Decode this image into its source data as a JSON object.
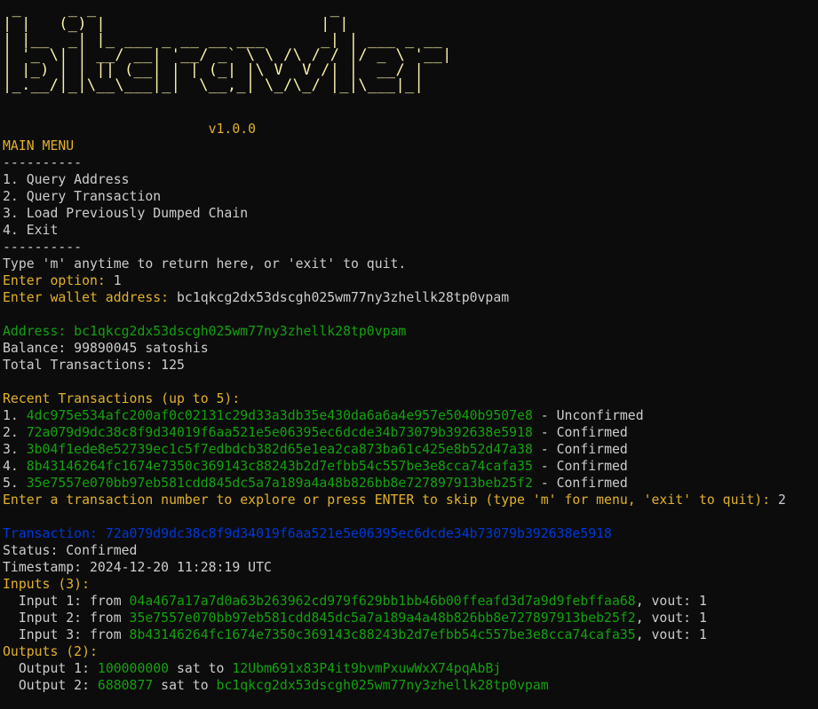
{
  "banner": [
    " _     _ _                         _",
    "| |   (_) |                       | |",
    "| |__  _| |_ ___ _ __ __ ___      _| | ___ _ __",
    "| '_ \\| | __/ __| '__/ _` \\ \\ /\\ / / |/ _ \\ '__|",
    "| |_) | | || (__| | | (_| |\\ V  V /| |  __/ |",
    "|_.__/|_|\\__\\___|_|  \\__,_| \\_/\\_/ |_|\\___|_|"
  ],
  "version": "                          v1.0.0",
  "menu": {
    "title": "MAIN MENU",
    "separator": "----------",
    "items": [
      "1. Query Address",
      "2. Query Transaction",
      "3. Load Previously Dumped Chain",
      "4. Exit"
    ],
    "separator_bottom": "----------",
    "hint": "Type 'm' anytime to return here, or 'exit' to quit."
  },
  "prompts": {
    "option_label": "Enter option: ",
    "option_value": "1",
    "wallet_label": "Enter wallet address: ",
    "wallet_value": "bc1qkcg2dx53dscgh025wm77ny3zhellk28tp0vpam"
  },
  "address_info": {
    "address_line": "Address: bc1qkcg2dx53dscgh025wm77ny3zhellk28tp0vpam",
    "balance_line": "Balance: 99890045 satoshis",
    "total_line": "Total Transactions: 125"
  },
  "recent": {
    "title": "Recent Transactions (up to 5):",
    "items": [
      {
        "num": "1. ",
        "hash": "4dc975e534afc200af0c02131c29d33a3db35e430da6a6a4e957e5040b9507e8",
        "status": " - Unconfirmed"
      },
      {
        "num": "2. ",
        "hash": "72a079d9dc38c8f9d34019f6aa521e5e06395ec6dcde34b73079b392638e5918",
        "status": " - Confirmed"
      },
      {
        "num": "3. ",
        "hash": "3b04f1ede8e52739ec1c5f7edbdcb382d65e1ea2ca873ba61c425e8b52d47a38",
        "status": " - Confirmed"
      },
      {
        "num": "4. ",
        "hash": "8b43146264fc1674e7350c369143c88243b2d7efbb54c557be3e8cca74cafa35",
        "status": " - Confirmed"
      },
      {
        "num": "5. ",
        "hash": "35e7557e070bb97eb581cdd845dc5a7a189a4a48b826bb8e727897913beb25f2",
        "status": " - Confirmed"
      }
    ],
    "explore_prompt": "Enter a transaction number to explore or press ENTER to skip (type 'm' for menu, 'exit' to quit): ",
    "explore_value": "2"
  },
  "transaction": {
    "label": "Transaction: ",
    "hash": "72a079d9dc38c8f9d34019f6aa521e5e06395ec6dcde34b73079b392638e5918",
    "status_line": "Status: Confirmed",
    "timestamp_line": "Timestamp: 2024-12-20 11:28:19 UTC",
    "inputs_title": "Inputs (3):",
    "inputs": [
      {
        "prefix": "  Input 1: from ",
        "hash": "04a467a17a7d0a63b263962cd979f629bb1bb46b00ffeafd3d7a9d9febffaa68",
        "suffix": ", vout: 1"
      },
      {
        "prefix": "  Input 2: from ",
        "hash": "35e7557e070bb97eb581cdd845dc5a7a189a4a48b826bb8e727897913beb25f2",
        "suffix": ", vout: 1"
      },
      {
        "prefix": "  Input 3: from ",
        "hash": "8b43146264fc1674e7350c369143c88243b2d7efbb54c557be3e8cca74cafa35",
        "suffix": ", vout: 1"
      }
    ],
    "outputs_title": "Outputs (2):",
    "outputs": [
      {
        "prefix": "  Output 1: ",
        "amount": "100000000",
        "mid": " sat to ",
        "address": "12Ubm691x83P4it9bvmPxuwWxX74pqAbBj"
      },
      {
        "prefix": "  Output 2: ",
        "amount": "6880877",
        "mid": " sat to ",
        "address": "bc1qkcg2dx53dscgh025wm77ny3zhellk28tp0vpam"
      }
    ]
  },
  "colors": {
    "background": "#0c0c0c",
    "text": "#cccccc",
    "yellow": "#e1b12c",
    "banner": "#f9f1a5",
    "green": "#13a10e",
    "blue": "#0037da"
  }
}
